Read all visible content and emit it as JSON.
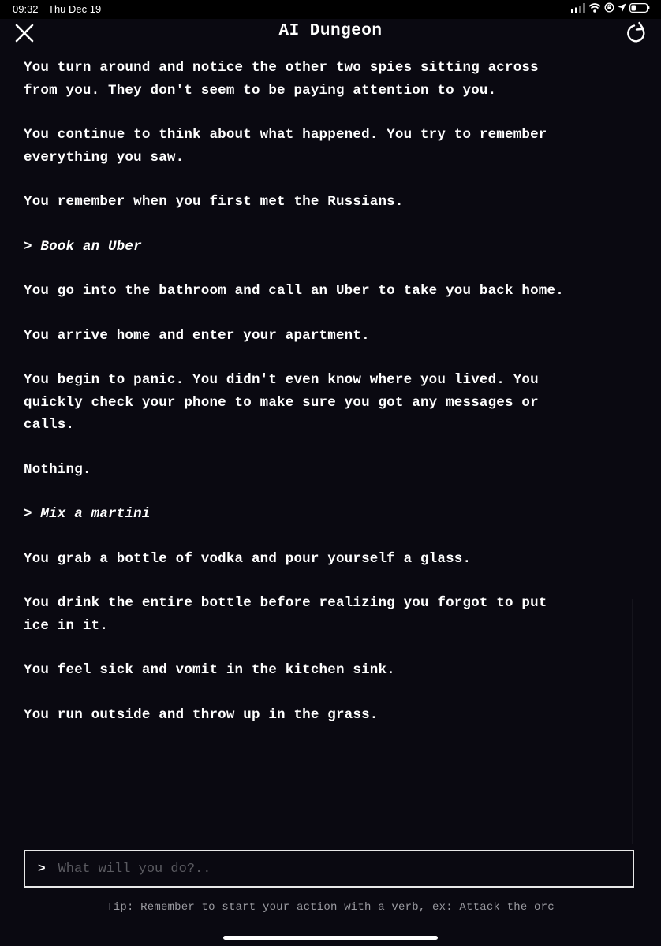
{
  "status_bar": {
    "time": "09:32",
    "date": "Thu Dec 19",
    "icons": [
      "signal-icon",
      "wifi-icon",
      "lock-rotation-icon",
      "location-icon",
      "battery-icon"
    ]
  },
  "header": {
    "title": "AI Dungeon",
    "close_icon": "close-icon",
    "refresh_icon": "refresh-icon"
  },
  "story": {
    "entries": [
      {
        "type": "narration",
        "text": "You turn around and notice the other two spies sitting across from you. They don't seem to be paying attention to you."
      },
      {
        "type": "narration",
        "text": "You continue to think about what happened. You try to remember everything you saw."
      },
      {
        "type": "narration",
        "text": "You remember when you first met the Russians."
      },
      {
        "type": "action",
        "text": "> Book an Uber"
      },
      {
        "type": "narration",
        "text": "You go into the bathroom and call an Uber to take you back home."
      },
      {
        "type": "narration",
        "text": "You arrive home and enter your apartment."
      },
      {
        "type": "narration",
        "text": "You begin to panic. You didn't even know where you lived. You quickly check your phone to make sure you got any messages or calls."
      },
      {
        "type": "narration",
        "text": "Nothing."
      },
      {
        "type": "action",
        "text": "> Mix a martini"
      },
      {
        "type": "narration",
        "text": "You grab a bottle of vodka and pour yourself a glass."
      },
      {
        "type": "narration",
        "text": "You drink the entire bottle before realizing you forgot to put ice in it."
      },
      {
        "type": "narration",
        "text": "You feel sick and vomit in the kitchen sink."
      },
      {
        "type": "narration",
        "text": "You run outside and throw up in the grass."
      }
    ]
  },
  "input": {
    "prompt": ">",
    "placeholder": "What will you do?..",
    "value": ""
  },
  "tip": "Tip: Remember to start your action with a verb, ex: Attack the orc",
  "colors": {
    "background": "#0a0911",
    "text": "#ffffff",
    "tip": "#9a9aa0",
    "placeholder": "#5a5a60"
  }
}
